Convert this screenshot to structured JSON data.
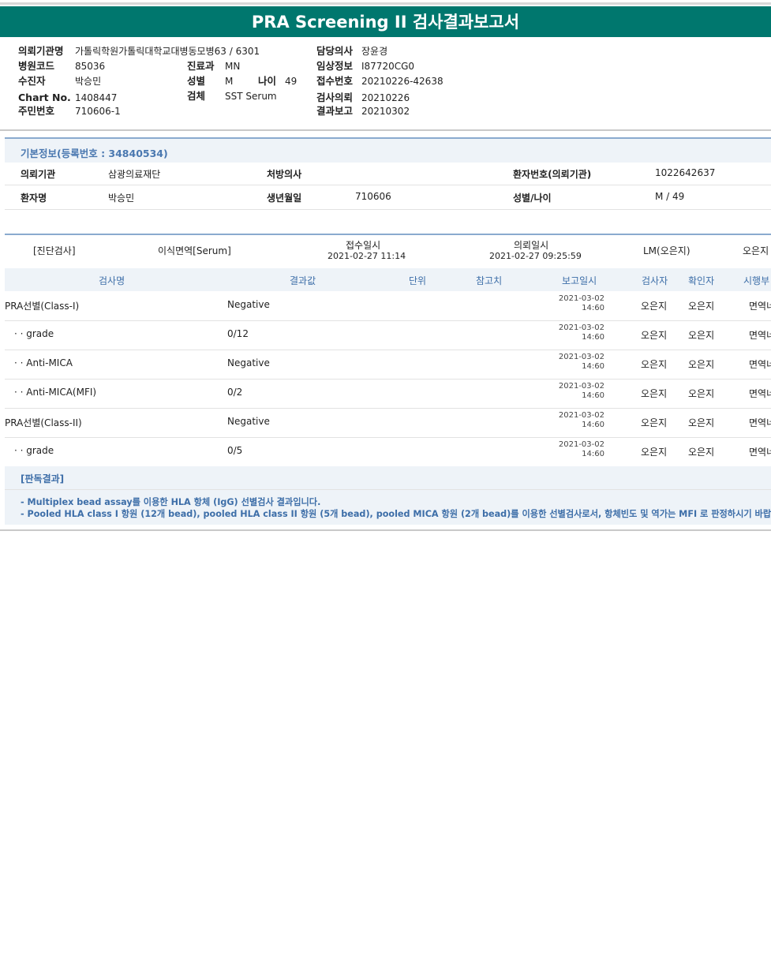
{
  "title": "PRA Screening II 검사결과보고서",
  "header": {
    "institution_label": "의뢰기관명",
    "institution_value": "가톨릭학원가톨릭대학교대병동모병63 / 6301",
    "hospital_code_label": "병원코드",
    "hospital_code_value": "85036",
    "recipient_label": "수진자",
    "recipient_value": "박승민",
    "chart_label": "Chart No.",
    "chart_value": "1408447",
    "resident_label": "주민번호",
    "resident_value": "710606-1",
    "dept_label": "진료과",
    "dept_value": "MN",
    "sex_label": "성별",
    "sex_value": "M",
    "age_label": "나이",
    "age_value": "49",
    "specimen_label": "검체",
    "specimen_value": "SST Serum",
    "doctor_label": "담당의사",
    "doctor_value": "장윤경",
    "clinical_label": "임상정보",
    "clinical_value": "I87720CG0",
    "receipt_label": "접수번호",
    "receipt_value": "20210226-42638",
    "request_label": "검사의뢰",
    "request_value": "20210226",
    "report_label": "결과보고",
    "report_value": "20210302"
  },
  "basic": {
    "heading": "기본정보(등록번호 : 34840534)",
    "req_inst_label": "의뢰기관",
    "req_inst_value": "삼광의료재단",
    "presc_label": "처방의사",
    "presc_value": "",
    "patient_no_label": "환자번호(의뢰기관)",
    "patient_no_value": "1022642637",
    "name_label": "환자명",
    "name_value": "박승민",
    "dob_label": "생년월일",
    "dob_value": "710606",
    "sexage_label": "성별/나이",
    "sexage_value": "M / 49"
  },
  "exam": {
    "category": "[진단검사]",
    "specimen": "이식면역[Serum]",
    "receipt_label": "접수일시",
    "receipt_value": "2021-02-27  11:14",
    "request_label": "의뢰일시",
    "request_value": "2021-02-27  09:25:59",
    "lm": "LM(오은지)",
    "extra": "오은지"
  },
  "columns": {
    "name": "검사명",
    "result": "결과값",
    "unit": "단위",
    "ref": "참고치",
    "report_date": "보고일시",
    "tester": "검사자",
    "confirmer": "확인자",
    "dept": "시행부"
  },
  "results": [
    {
      "name": "PRA선별(Class-I)",
      "value": "Negative",
      "date": "2021-03-02",
      "time": "14:60",
      "tester": "오은지",
      "confirmer": "오은지",
      "dept": "면역네"
    },
    {
      "name": "· · grade",
      "value": "0/12",
      "date": "2021-03-02",
      "time": "14:60",
      "tester": "오은지",
      "confirmer": "오은지",
      "dept": "면역네"
    },
    {
      "name": "· · Anti-MICA",
      "value": "Negative",
      "date": "2021-03-02",
      "time": "14:60",
      "tester": "오은지",
      "confirmer": "오은지",
      "dept": "면역네"
    },
    {
      "name": "· · Anti-MICA(MFI)",
      "value": "0/2",
      "date": "2021-03-02",
      "time": "14:60",
      "tester": "오은지",
      "confirmer": "오은지",
      "dept": "면역네"
    },
    {
      "name": "PRA선별(Class-II)",
      "value": "Negative",
      "date": "2021-03-02",
      "time": "14:60",
      "tester": "오은지",
      "confirmer": "오은지",
      "dept": "면역네"
    },
    {
      "name": "· · grade",
      "value": "0/5",
      "date": "2021-03-02",
      "time": "14:60",
      "tester": "오은지",
      "confirmer": "오은지",
      "dept": "면역네"
    }
  ],
  "judgement": {
    "heading": "[판독결과]",
    "line1": "- Multiplex bead assay를 이용한 HLA 항체 (IgG) 선별검사 결과입니다.",
    "line2": "- Pooled HLA class I 항원 (12개 bead), pooled HLA class II 항원 (5개 bead), pooled MICA 항원 (2개 bead)를 이용한 선별검사로서, 항체빈도 및 역가는 MFI 로 판정하시기 바랍니다."
  }
}
